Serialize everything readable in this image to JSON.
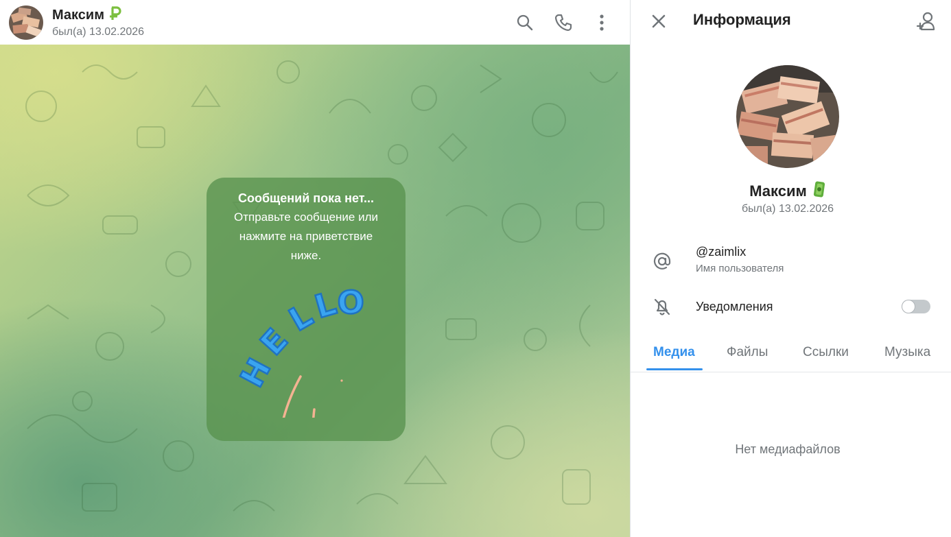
{
  "chat": {
    "name": "Максим",
    "status": "был(а) 13.02.2026",
    "badge_icon": "ruble-emoji-icon",
    "actions": [
      "search-icon",
      "phone-icon",
      "more-vertical-icon"
    ]
  },
  "empty_state": {
    "title": "Сообщений пока нет...",
    "description": "Отправьте сообщение или нажмите на приветствие ниже.",
    "sticker_text": "HELLO"
  },
  "info_panel": {
    "title": "Информация",
    "profile": {
      "name": "Максим",
      "status": "был(а) 13.02.2026",
      "badge_icon": "banknote-emoji-icon"
    },
    "username": {
      "value": "@zaimlix",
      "label": "Имя пользователя"
    },
    "notifications": {
      "label": "Уведомления",
      "enabled": false
    },
    "tabs": [
      {
        "label": "Медиа",
        "active": true
      },
      {
        "label": "Файлы",
        "active": false
      },
      {
        "label": "Ссылки",
        "active": false
      },
      {
        "label": "Музыка",
        "active": false
      }
    ],
    "empty_media": "Нет медиафайлов"
  },
  "colors": {
    "accent": "#3390ec",
    "secondary_text": "#707579",
    "card_bg": "#5c9250"
  }
}
